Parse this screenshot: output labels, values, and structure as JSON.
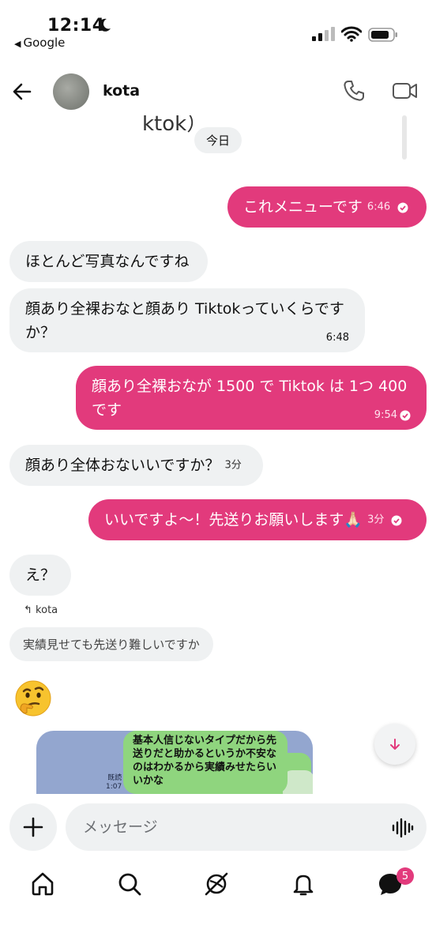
{
  "status_bar": {
    "time": "12:14",
    "back_app": "Google"
  },
  "header": {
    "contact_name": "kota"
  },
  "thread": {
    "cut_text": "ktok）",
    "date_chip": "今日",
    "messages": [
      {
        "direction": "out",
        "text": "これメニューです",
        "time": "6:46",
        "read": true
      },
      {
        "direction": "in",
        "text": "ほとんど写真なんですね",
        "time": ""
      },
      {
        "direction": "in",
        "text": "顔あり全裸おなと顔あり Tiktokっていくらですか？",
        "time": "6:48"
      },
      {
        "direction": "out",
        "text": "顔あり全裸おなが 1500 で Tiktok は 1つ 400 です",
        "time": "9:54",
        "read": true
      },
      {
        "direction": "in",
        "text": "顔あり全体おないいですか？",
        "time": "3分"
      },
      {
        "direction": "out",
        "text": "いいですよ〜！先送りお願いします🙏🏻",
        "time": "3分",
        "read": true
      },
      {
        "direction": "in",
        "text": "え？",
        "time": ""
      }
    ],
    "reply": {
      "label": "kota",
      "quote": "実績見せても先送り難しいですか"
    },
    "emoji_message": "🤔",
    "embedded_image": {
      "read_label": "既読",
      "read_time": "1:07",
      "bubble_text": "基本人信じないタイプだから先送りだと助かるというか不安なのはわかるから実績みせたらいいかな"
    }
  },
  "composer": {
    "placeholder": "メッセージ"
  },
  "nav": {
    "messages_badge": "5"
  },
  "colors": {
    "accent": "#e23a7c",
    "incoming_bubble": "#eff1f2",
    "line_green": "#8fd57e"
  }
}
